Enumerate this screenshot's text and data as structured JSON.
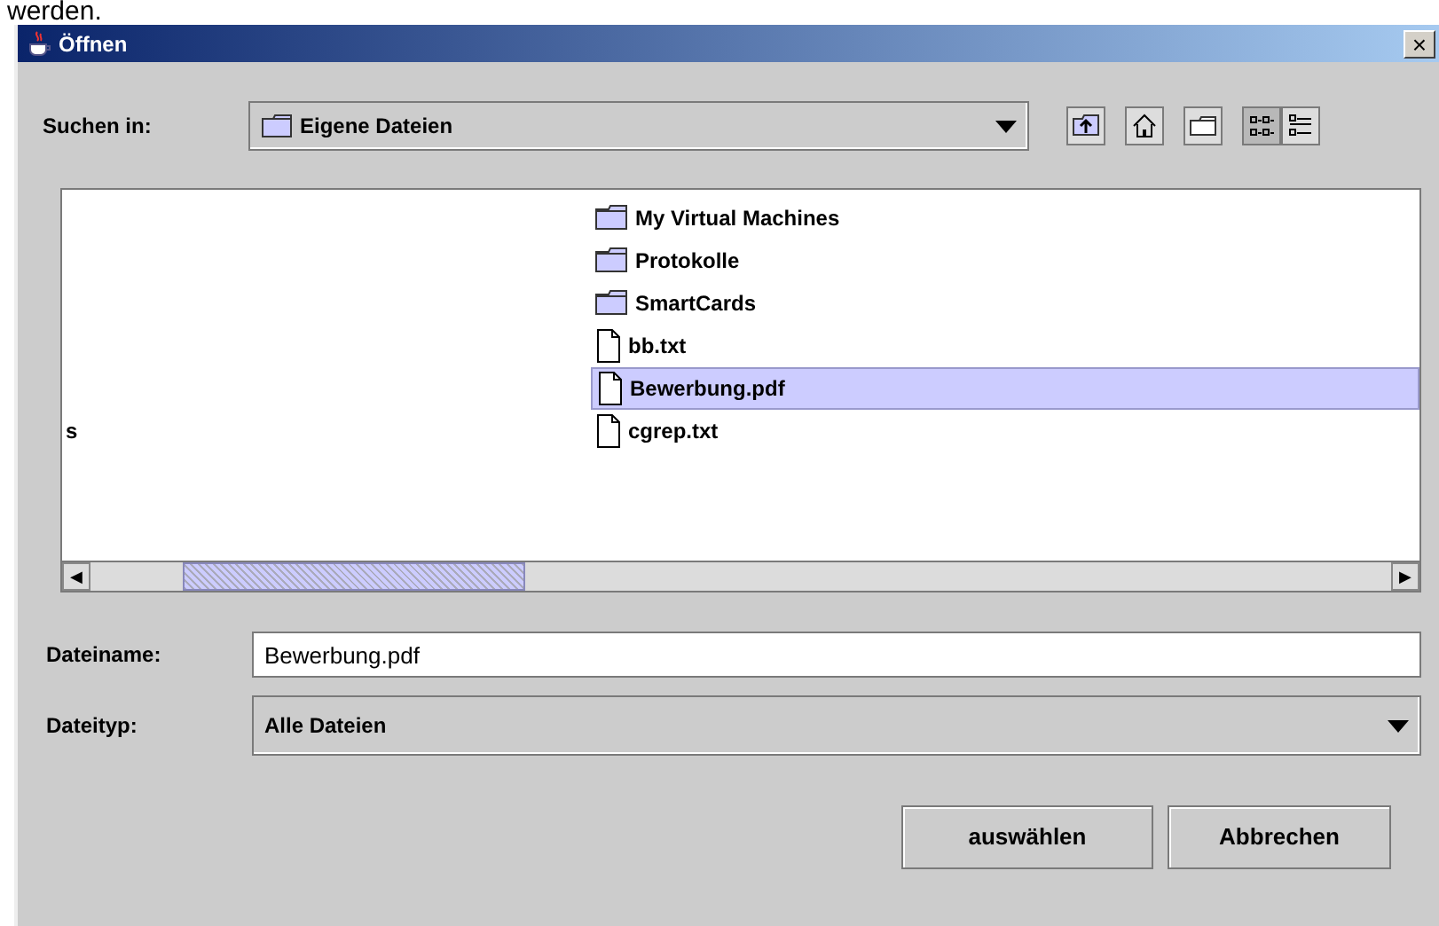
{
  "background_text": "werden.",
  "window": {
    "title": "Öffnen",
    "close": "×"
  },
  "look_in": {
    "label": "Suchen in:",
    "value": "Eigene Dateien"
  },
  "toolbar": [
    {
      "kind": "up",
      "selected": false
    },
    {
      "kind": "home",
      "selected": false
    },
    {
      "kind": "newfolder",
      "selected": false
    },
    {
      "kind": "list",
      "selected": true
    },
    {
      "kind": "details",
      "selected": false
    }
  ],
  "file_columns": [
    [
      {
        "name": "s",
        "kind": "cut",
        "selected": false
      }
    ],
    [
      {
        "name": "My Virtual Machines",
        "kind": "folder",
        "selected": false
      },
      {
        "name": "Protokolle",
        "kind": "folder",
        "selected": false
      },
      {
        "name": "SmartCards",
        "kind": "folder",
        "selected": false
      },
      {
        "name": "bb.txt",
        "kind": "file",
        "selected": false
      },
      {
        "name": "Bewerbung.pdf",
        "kind": "file",
        "selected": true
      },
      {
        "name": "cgrep.txt",
        "kind": "file",
        "selected": false
      }
    ]
  ],
  "scrollbar": {
    "left": "◀",
    "right": "▶"
  },
  "file_name": {
    "label": "Dateiname:",
    "value": "Bewerbung.pdf"
  },
  "file_type": {
    "label": "Dateityp:",
    "value": "Alle Dateien"
  },
  "buttons": [
    "auswählen",
    "Abbrechen"
  ]
}
